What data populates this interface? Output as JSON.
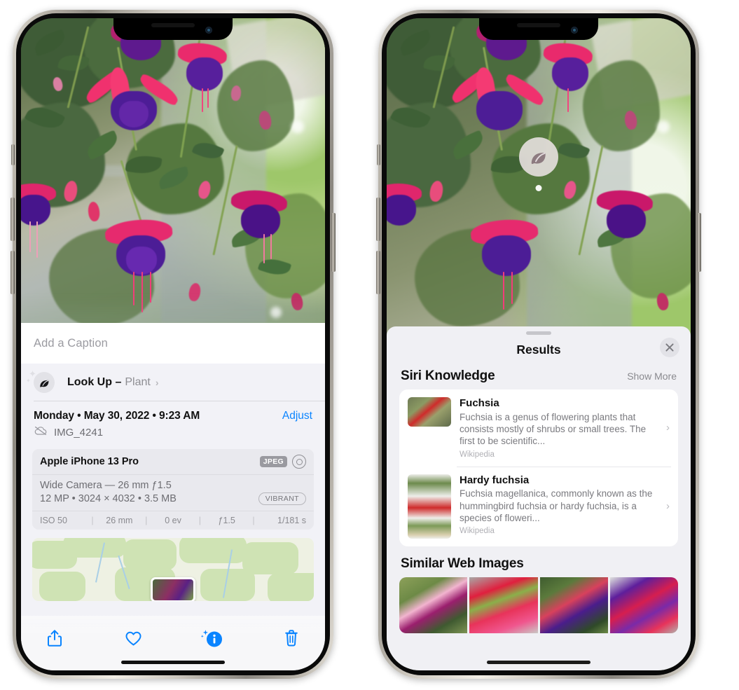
{
  "left_phone": {
    "caption": {
      "placeholder": "Add a Caption",
      "value": ""
    },
    "look_up": {
      "label": "Look Up –",
      "subject": "Plant",
      "chevron": "›",
      "icon": "leaf-icon"
    },
    "date_row": {
      "date": "Monday • May 30, 2022 • 9:23 AM",
      "adjust_label": "Adjust"
    },
    "file_row": {
      "icon": "icloud-slash-icon",
      "filename": "IMG_4241"
    },
    "metadata": {
      "device": "Apple iPhone 13 Pro",
      "format_tag": "JPEG",
      "lens_icon": "lens-icon",
      "lens_line": "Wide Camera — 26 mm ƒ1.5",
      "size_line": "12 MP • 3024 × 4032 • 3.5 MB",
      "style_tag": "VIBRANT",
      "exif": [
        "ISO 50",
        "26 mm",
        "0 ev",
        "ƒ1.5",
        "1/181 s"
      ]
    },
    "toolbar": [
      {
        "name": "share-button",
        "icon": "share-icon"
      },
      {
        "name": "favorite-button",
        "icon": "heart-icon"
      },
      {
        "name": "info-button",
        "icon": "info-sparkle-icon"
      },
      {
        "name": "delete-button",
        "icon": "trash-icon"
      }
    ],
    "accent_color": "#0a84ff"
  },
  "right_phone": {
    "visual_lookup_badge": {
      "icon": "leaf-icon"
    },
    "sheet": {
      "title": "Results",
      "close_icon": "close-icon",
      "siri_knowledge": {
        "title": "Siri Knowledge",
        "show_more": "Show More",
        "items": [
          {
            "title": "Fuchsia",
            "description": "Fuchsia is a genus of flowering plants that consists mostly of shrubs or small trees. The first to be scientific...",
            "source": "Wikipedia",
            "chevron": "›"
          },
          {
            "title": "Hardy fuchsia",
            "description": "Fuchsia magellanica, commonly known as the hummingbird fuchsia or hardy fuchsia, is a species of floweri...",
            "source": "Wikipedia",
            "chevron": "›"
          }
        ]
      },
      "similar_web_images": {
        "title": "Similar Web Images",
        "count": 4
      }
    }
  },
  "colors": {
    "accent": "#0a84ff",
    "sheet_bg": "#f0f0f4",
    "info_bg": "#f2f2f7",
    "card_bg": "#ffffff",
    "muted_text": "#8e8e93"
  }
}
